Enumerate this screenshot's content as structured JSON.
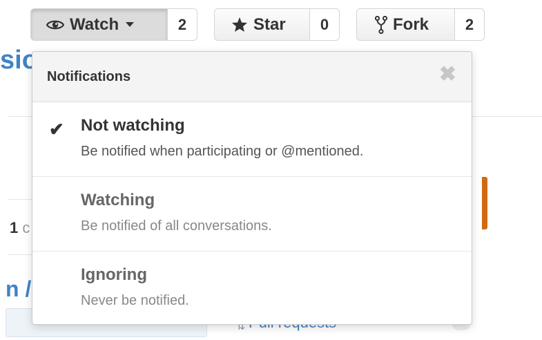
{
  "repo_actions": {
    "watch": {
      "label": "Watch",
      "count": "2",
      "icon": "eye-icon"
    },
    "star": {
      "label": "Star",
      "count": "0",
      "icon": "star-icon"
    },
    "fork": {
      "label": "Fork",
      "count": "2",
      "icon": "fork-icon"
    }
  },
  "background": {
    "title_fragment": "sio",
    "count_number": "1",
    "count_rest": "c",
    "heading_fragment": "n /",
    "pull_requests": "Pull requests"
  },
  "notifications": {
    "title": "Notifications",
    "close_icon": "close-icon",
    "options": [
      {
        "label": "Not watching",
        "description": "Be notified when participating or @mentioned.",
        "selected": true
      },
      {
        "label": "Watching",
        "description": "Be notified of all conversations.",
        "selected": false
      },
      {
        "label": "Ignoring",
        "description": "Never be notified.",
        "selected": false
      }
    ]
  },
  "colors": {
    "link": "#4183c4",
    "accent_orange": "#d26911"
  }
}
